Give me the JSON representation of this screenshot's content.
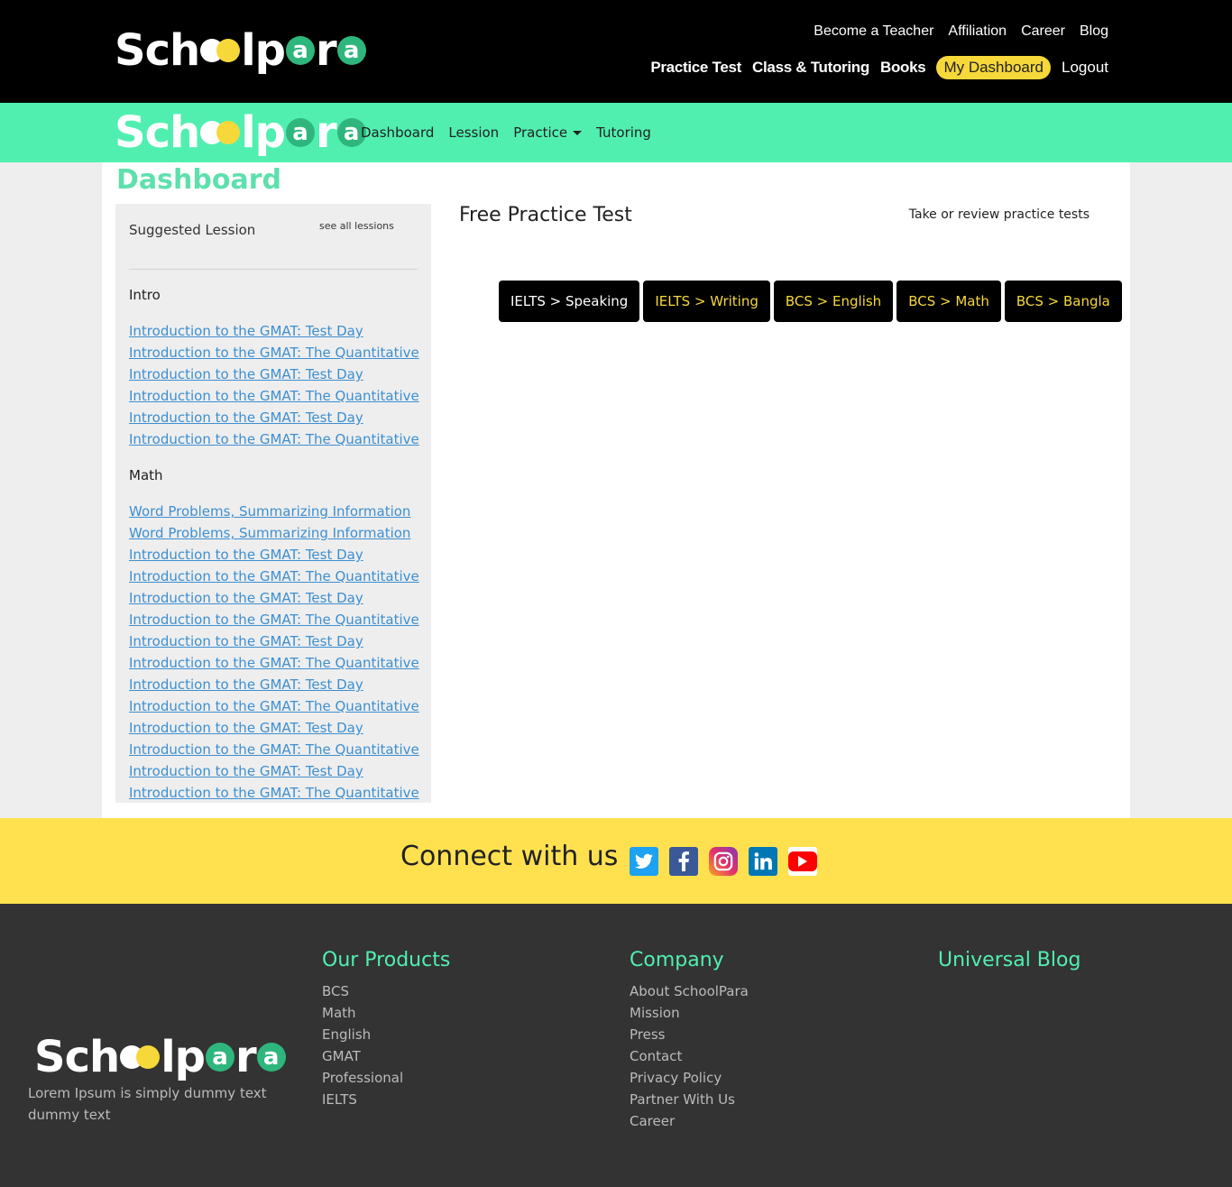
{
  "brand": {
    "logo": "Schoolpara",
    "logo_parts": [
      "Sch",
      "lp",
      "a",
      "r",
      "a"
    ],
    "colors": {
      "accent_green": "#50efb0",
      "accent_yellow": "#f7d83a",
      "logo_green": "#2eb67d"
    }
  },
  "top_header": {
    "links": [
      "Become a Teacher",
      "Affiliation",
      "Career",
      "Blog"
    ],
    "practice_test": "Practice Test",
    "class_tutoring": "Class & Tutoring",
    "books": "Books",
    "my_dashboard": "My Dashboard",
    "logout": "Logout"
  },
  "green_nav": {
    "dashboard": "Dashboard",
    "lession": "Lession",
    "practice": "Practice",
    "tutoring": "Tutoring"
  },
  "main": {
    "title": "Dashboard",
    "suggested": {
      "heading": "Suggested Lession",
      "see_all": "see all lessions",
      "groups": [
        {
          "name": "Intro",
          "items": [
            "Introduction to the GMAT: Test Day",
            "Introduction to the GMAT: The Quantitative",
            "Introduction to the GMAT: Test Day",
            "Introduction to the GMAT: The Quantitative",
            "Introduction to the GMAT: Test Day",
            "Introduction to the GMAT: The Quantitative"
          ]
        },
        {
          "name": "Math",
          "items": [
            "Word Problems, Summarizing Information",
            "Word Problems, Summarizing Information",
            "Introduction to the GMAT: Test Day",
            "Introduction to the GMAT: The Quantitative",
            "Introduction to the GMAT: Test Day",
            "Introduction to the GMAT: The Quantitative",
            "Introduction to the GMAT: Test Day",
            "Introduction to the GMAT: The Quantitative",
            "Introduction to the GMAT: Test Day",
            "Introduction to the GMAT: The Quantitative",
            "Introduction to the GMAT: Test Day",
            "Introduction to the GMAT: The Quantitative",
            "Introduction to the GMAT: Test Day",
            "Introduction to the GMAT: The Quantitative"
          ]
        }
      ]
    },
    "practice": {
      "title": "Free Practice Test",
      "subtitle": "Take or review practice tests",
      "tests": [
        "IELTS > Speaking",
        "IELTS > Writing",
        "BCS > English",
        "BCS > Math",
        "BCS > Bangla"
      ]
    }
  },
  "connect": {
    "title": "Connect with us",
    "icons": [
      "twitter-icon",
      "facebook-icon",
      "instagram-icon",
      "linkedin-icon",
      "youtube-icon"
    ]
  },
  "footer": {
    "description": "Lorem Ipsum is simply dummy text dummy text",
    "products": {
      "title": "Our Products",
      "items": [
        "BCS",
        "Math",
        "English",
        "GMAT",
        "Professional",
        "IELTS"
      ]
    },
    "company": {
      "title": "Company",
      "items": [
        "About SchoolPara",
        "Mission",
        "Press",
        "Contact",
        "Privacy Policy",
        "Partner With Us",
        "Career"
      ]
    },
    "blog": {
      "title": "Universal Blog"
    }
  }
}
